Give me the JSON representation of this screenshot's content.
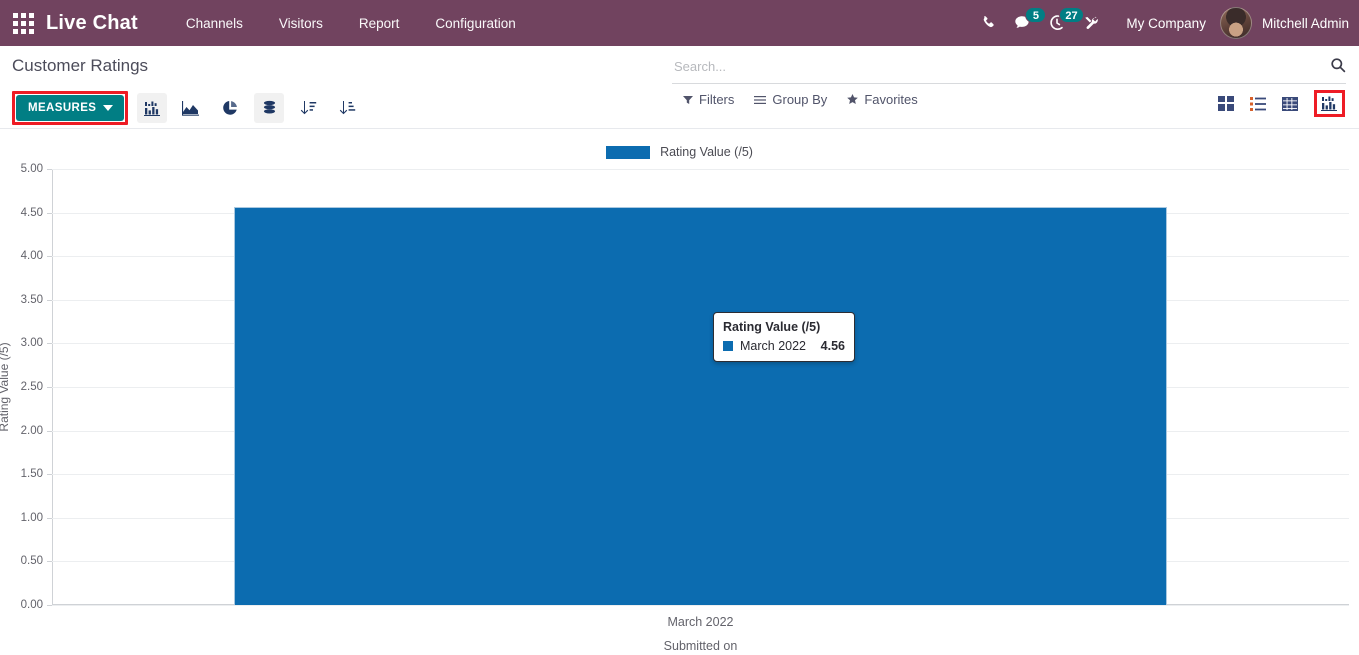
{
  "navbar": {
    "apps_icon": "apps-grid-icon",
    "brand": "Live Chat",
    "menu": [
      {
        "label": "Channels"
      },
      {
        "label": "Visitors"
      },
      {
        "label": "Report"
      },
      {
        "label": "Configuration"
      }
    ],
    "icons": [
      {
        "name": "phone-icon",
        "badge": null
      },
      {
        "name": "messages-icon",
        "badge": "5"
      },
      {
        "name": "activities-clock-icon",
        "badge": "27"
      },
      {
        "name": "debug-tools-icon",
        "badge": null
      }
    ],
    "company": "My Company",
    "user": "Mitchell Admin",
    "background_color": "#71435F",
    "badge_color": "#017E84"
  },
  "control_panel": {
    "title": "Customer Ratings",
    "measures_label": "MEASURES",
    "measures_color": "#017E84",
    "highlight_color": "#EE1C25",
    "graph_buttons": [
      {
        "name": "bar-chart-button",
        "active": true
      },
      {
        "name": "line-area-chart-button",
        "active": false
      },
      {
        "name": "pie-chart-button",
        "active": false
      },
      {
        "name": "stacked-button",
        "active": true
      },
      {
        "name": "sort-descending-button",
        "active": false
      },
      {
        "name": "sort-ascending-button",
        "active": false
      }
    ],
    "search": {
      "placeholder": "Search...",
      "value": ""
    },
    "facets": [
      {
        "label": "Filters",
        "icon": "filter-icon"
      },
      {
        "label": "Group By",
        "icon": "group-by-icon"
      },
      {
        "label": "Favorites",
        "icon": "star-icon"
      }
    ],
    "views": [
      {
        "name": "kanban-view-button",
        "active": false
      },
      {
        "name": "list-view-button",
        "active": false
      },
      {
        "name": "pivot-view-button",
        "active": false
      },
      {
        "name": "graph-view-button",
        "active": true
      }
    ]
  },
  "chart_data": {
    "type": "bar",
    "title": "",
    "categories": [
      "March 2022"
    ],
    "values": [
      4.56
    ],
    "series": [
      {
        "name": "Rating Value (/5)",
        "values": [
          4.56
        ],
        "color": "#0C6CB0"
      }
    ],
    "xlabel": "Submitted on",
    "ylabel": "Rating Value (/5)",
    "ylim": [
      0,
      5
    ],
    "yticks": [
      "0.00",
      "0.50",
      "1.00",
      "1.50",
      "2.00",
      "2.50",
      "3.00",
      "3.50",
      "4.00",
      "4.50",
      "5.00"
    ],
    "ytick_values": [
      0,
      0.5,
      1,
      1.5,
      2,
      2.5,
      3,
      3.5,
      4,
      4.5,
      5
    ],
    "grid": true,
    "legend": {
      "position": "top",
      "entries": [
        "Rating Value (/5)"
      ]
    },
    "bar_color": "#0C6CB0"
  },
  "tooltip": {
    "title": "Rating Value (/5)",
    "key": "March 2022",
    "value": "4.56",
    "swatch_color": "#0C6CB0"
  }
}
